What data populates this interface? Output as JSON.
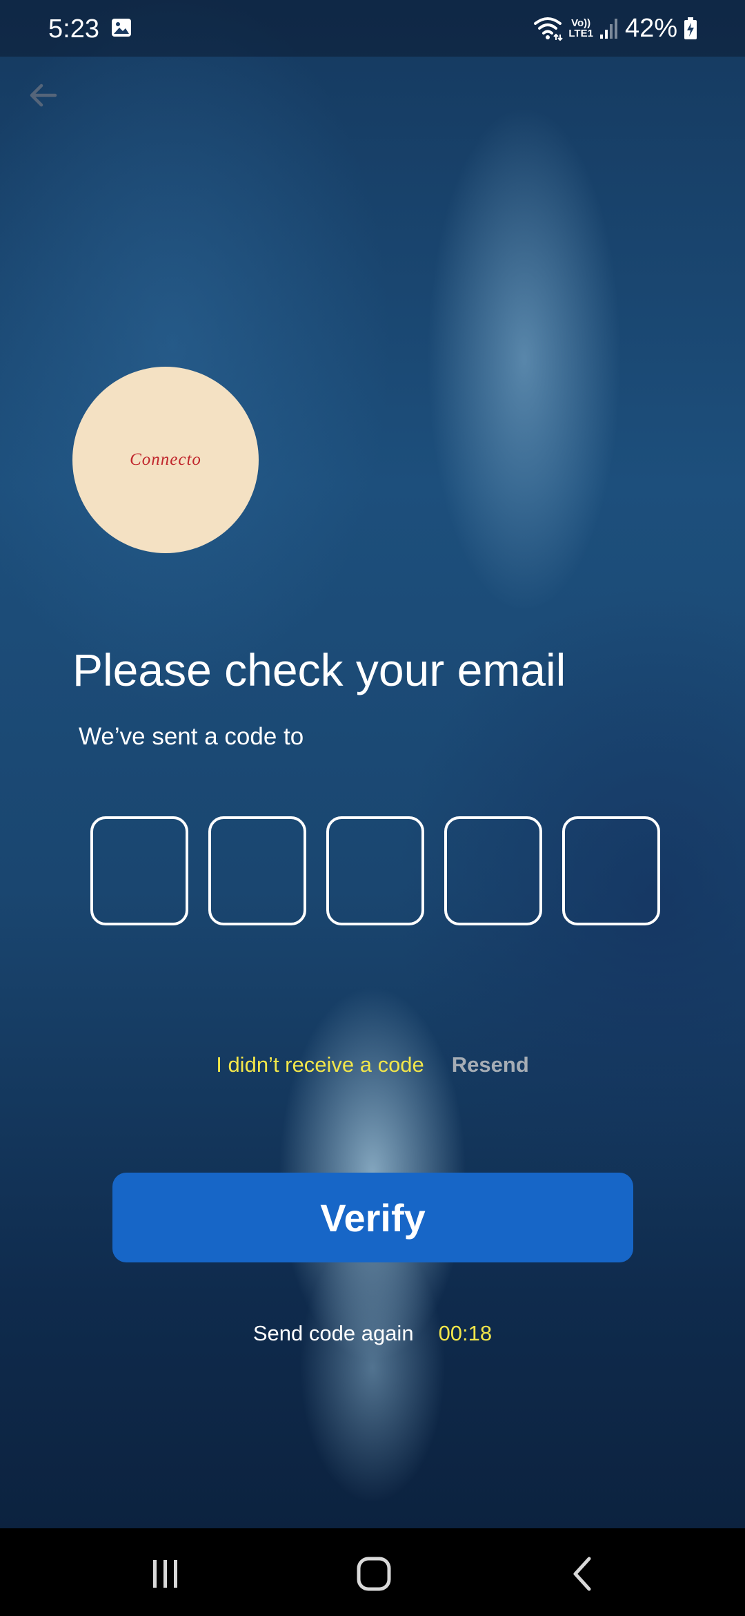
{
  "status_bar": {
    "time": "5:23",
    "network_top": "Vo))",
    "network_bottom": "LTE1",
    "battery": "42%"
  },
  "logo": {
    "text": "Connecto"
  },
  "title": "Please check your email",
  "subtitle": "We’ve sent a code to",
  "code_inputs": [
    "",
    "",
    "",
    "",
    ""
  ],
  "resend": {
    "prompt": "I didn’t receive a code",
    "link": "Resend"
  },
  "verify_label": "Verify",
  "timer": {
    "label": "Send code again",
    "value": "00:18"
  },
  "icons": {
    "back": "arrow-left-icon",
    "gallery": "image-icon",
    "wifi": "wifi-icon",
    "signal": "signal-icon",
    "battery": "battery-charging-icon",
    "nav_recent": "recent-apps-icon",
    "nav_home": "home-icon",
    "nav_back": "back-icon"
  },
  "colors": {
    "accent_button": "#1766c7",
    "highlight_text": "#f2e64a",
    "muted_link": "#a6adb5",
    "logo_background": "#f4e1c3",
    "logo_text": "#c0262c"
  }
}
